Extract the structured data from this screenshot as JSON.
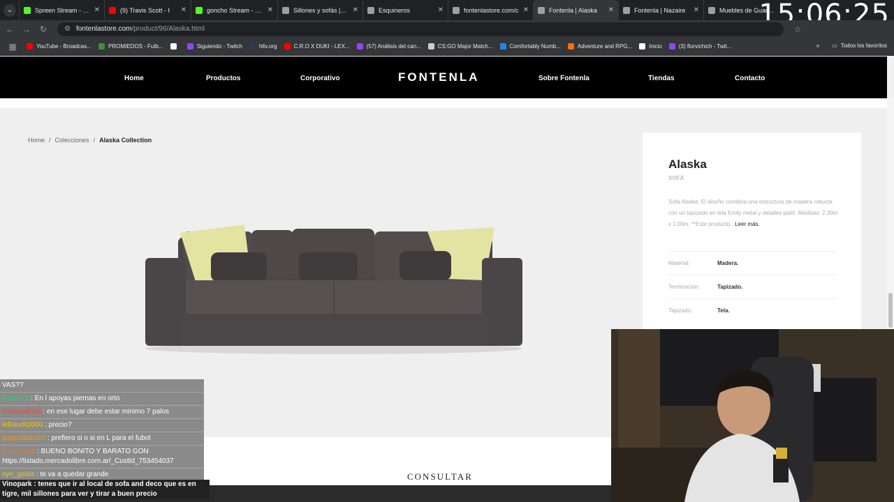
{
  "browser": {
    "tabs": [
      {
        "title": "Spreen Stream - Wat",
        "color": "#53fc18"
      },
      {
        "title": "(9) Travis Scott - I",
        "color": "#ff0000"
      },
      {
        "title": "goncho Stream - Wa",
        "color": "#53fc18"
      },
      {
        "title": "Sillones y sofás | Mo",
        "color": "#9aa0a6"
      },
      {
        "title": "Esquineros",
        "color": "#9aa0a6"
      },
      {
        "title": "fontenlastore.com/c",
        "color": "#9aa0a6"
      },
      {
        "title": "Fontenla | Alaska",
        "color": "#9aa0a6"
      },
      {
        "title": "Fontenla | Nazaire",
        "color": "#9aa0a6"
      },
      {
        "title": "Muebles de Guardad",
        "color": "#9aa0a6"
      }
    ],
    "clock": "15:06:25",
    "url_host": "fontenlastore.com",
    "url_path": "/product/96/Alaska.html",
    "bookmarks": [
      {
        "label": "YouTube - Broadcas...",
        "color": "#ff0000"
      },
      {
        "label": "PROMIEDOS - Futb...",
        "color": "#3a8f3a"
      },
      {
        "label": "",
        "color": "#ffffff"
      },
      {
        "label": "Siguiendo - Twitch",
        "color": "#9146ff"
      },
      {
        "label": "hltv.org",
        "color": "#2a3b55"
      },
      {
        "label": "C.R.O X DUKI - LEX...",
        "color": "#ff0000"
      },
      {
        "label": "(57) Análisis del can...",
        "color": "#9146ff"
      },
      {
        "label": "CS:GO Major Match...",
        "color": "#cccccc"
      },
      {
        "label": "Comfortably Numb...",
        "color": "#1e88e5"
      },
      {
        "label": "Adventure and RPG...",
        "color": "#ff6d00"
      },
      {
        "label": "Inicio",
        "color": "#ffffff"
      },
      {
        "label": "(3) florvichich - Twit...",
        "color": "#9146ff"
      }
    ],
    "all_bookmarks": "Todos los favoritos"
  },
  "site": {
    "nav": {
      "home": "Home",
      "productos": "Productos",
      "corporativo": "Corporativo",
      "logo": "FONTENLA",
      "sobre": "Sobre Fontenla",
      "tiendas": "Tiendas",
      "contacto": "Contacto"
    },
    "breadcrumb": {
      "home": "Home",
      "sep": "/",
      "colecciones": "Colecciones",
      "current": "Alaska Collection"
    },
    "product": {
      "title": "Alaska",
      "subtitle": "SOFÁ",
      "description": "Sofá Alaska. El diseño combina una estructura de madera robusta con un tapizado en tela Emily metal y detalles platil. Medidas: 2.30m x 1.00m. **Este producto..",
      "read_more": "Leer más.",
      "specs": [
        {
          "key": "Material:",
          "value": "Madera."
        },
        {
          "key": "Terminación:",
          "value": "Tapizado."
        },
        {
          "key": "Tapizado:",
          "value": "Tela."
        }
      ]
    },
    "consult": "CONSULTAR"
  },
  "chat": {
    "lines": [
      {
        "user": "",
        "color": "#ffffff",
        "text": "VAS??"
      },
      {
        "user": "Mateo7k",
        "color": "#2ecc71",
        "text": ": En l apoyas piernas en orto"
      },
      {
        "user": "marucadoral",
        "color": "#e74c3c",
        "text": ": en ese lugar debe estar minimo 7 palos"
      },
      {
        "user": "leBandit2000",
        "color": "#f1c40f",
        "text": ": precio?"
      },
      {
        "user": "joaquidiaba10",
        "color": "#f39c12",
        "text": ": prefiero si o si en L para el fubol"
      },
      {
        "user": "Kiranetask",
        "color": "#e67e22",
        "text": ": BUENO BONITO Y BARATO GON https://listado.mercadolibre.com.ar/_CustId_753454037"
      },
      {
        "user": "oye_gelda",
        "color": "#f1c40f",
        "text": ": te va a quedar grande"
      }
    ],
    "last": "Vinopark : tenes que ir al local de sofa and deco que es en tigre, mil sillones para ver y tirar a buen precio"
  }
}
